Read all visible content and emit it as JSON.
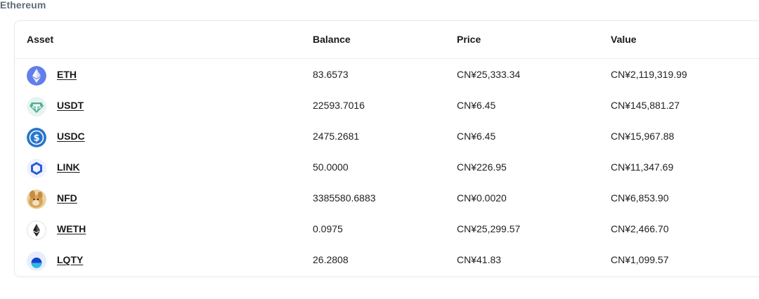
{
  "network": "Ethereum",
  "table": {
    "headers": {
      "asset": "Asset",
      "balance": "Balance",
      "price": "Price",
      "value": "Value"
    },
    "rows": [
      {
        "symbol": "ETH",
        "icon": "eth-icon",
        "balance": "83.6573",
        "price": "CN¥25,333.34",
        "value": "CN¥2,119,319.99"
      },
      {
        "symbol": "USDT",
        "icon": "usdt-icon",
        "balance": "22593.7016",
        "price": "CN¥6.45",
        "value": "CN¥145,881.27"
      },
      {
        "symbol": "USDC",
        "icon": "usdc-icon",
        "balance": "2475.2681",
        "price": "CN¥6.45",
        "value": "CN¥15,967.88"
      },
      {
        "symbol": "LINK",
        "icon": "link-icon",
        "balance": "50.0000",
        "price": "CN¥226.95",
        "value": "CN¥11,347.69"
      },
      {
        "symbol": "NFD",
        "icon": "nfd-icon",
        "balance": "3385580.6883",
        "price": "CN¥0.0020",
        "value": "CN¥6,853.90"
      },
      {
        "symbol": "WETH",
        "icon": "weth-icon",
        "balance": "0.0975",
        "price": "CN¥25,299.57",
        "value": "CN¥2,466.70"
      },
      {
        "symbol": "LQTY",
        "icon": "lqty-icon",
        "balance": "26.2808",
        "price": "CN¥41.83",
        "value": "CN¥1,099.57"
      }
    ]
  },
  "colors": {
    "eth": "#627eea",
    "usdt": "#50af95",
    "usdc": "#2775ca",
    "link": "#2a5ada",
    "nfd": "#d9a45a",
    "weth": "#1f1f1f",
    "lqty": "#1542cd"
  }
}
